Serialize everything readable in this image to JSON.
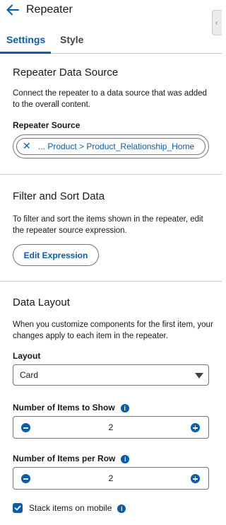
{
  "header": {
    "title": "Repeater"
  },
  "tabs": [
    {
      "label": "Settings",
      "active": true
    },
    {
      "label": "Style",
      "active": false
    }
  ],
  "data_source": {
    "title": "Repeater Data Source",
    "description": "Connect the repeater to a data source that was added to the overall content.",
    "source_label": "Repeater Source",
    "source_value": "... Product > Product_Relationship_Home"
  },
  "filter_sort": {
    "title": "Filter and Sort Data",
    "description": "To filter and sort the items shown in the repeater, edit the repeater source expression.",
    "button_label": "Edit Expression"
  },
  "data_layout": {
    "title": "Data Layout",
    "description": "When you customize components for the first item, your changes apply to each item in the repeater.",
    "layout_label": "Layout",
    "layout_value": "Card",
    "items_to_show_label": "Number of Items to Show",
    "items_to_show_value": "2",
    "items_per_row_label": "Number of Items per Row",
    "items_per_row_value": "2",
    "stack_mobile_label": "Stack items on mobile",
    "stack_mobile_checked": true
  },
  "colors": {
    "accent": "#0b5cab",
    "text": "#181818",
    "border": "#747474",
    "divider": "#c9c9c9"
  },
  "icons": {
    "back": "arrow-left-icon",
    "info": "info-icon",
    "remove": "close-icon",
    "decrement": "minus-circle-icon",
    "increment": "plus-circle-icon",
    "dropdown": "caret-down-icon",
    "check": "check-icon"
  }
}
